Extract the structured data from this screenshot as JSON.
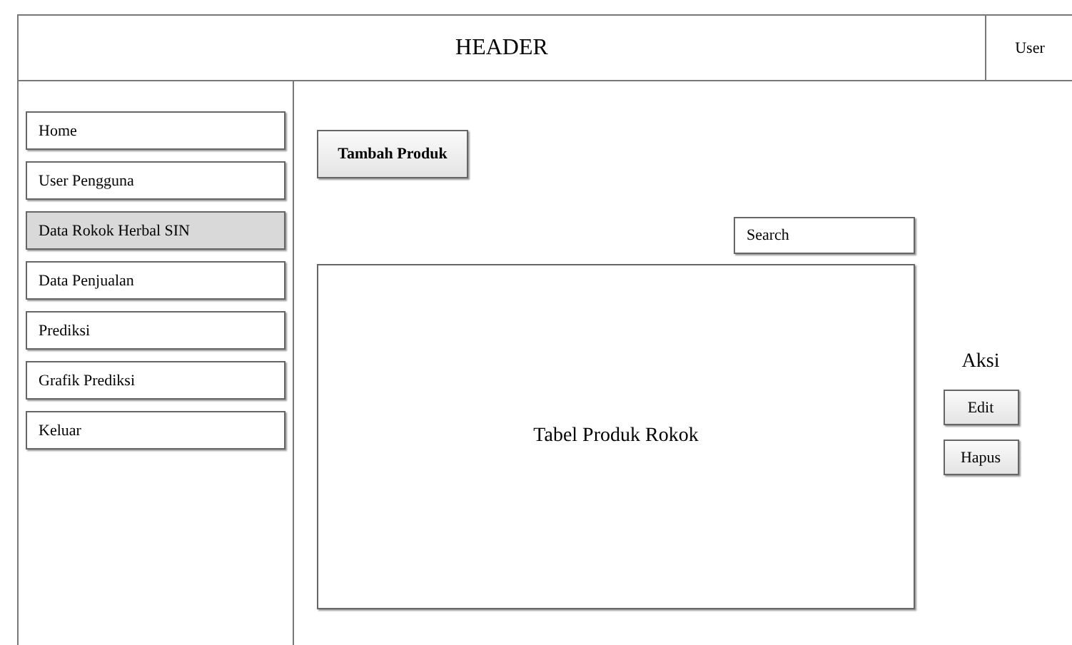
{
  "header": {
    "title": "HEADER",
    "user": "User"
  },
  "sidebar": {
    "items": [
      {
        "label": "Home",
        "selected": false
      },
      {
        "label": "User Pengguna",
        "selected": false
      },
      {
        "label": "Data Rokok Herbal SIN",
        "selected": true
      },
      {
        "label": "Data Penjualan",
        "selected": false
      },
      {
        "label": "Prediksi",
        "selected": false
      },
      {
        "label": "Grafik Prediksi",
        "selected": false
      },
      {
        "label": "Keluar",
        "selected": false
      }
    ]
  },
  "main": {
    "add_button": "Tambah Produk",
    "search": {
      "placeholder": "Search"
    },
    "table": {
      "label": "Tabel Produk Rokok"
    },
    "actions": {
      "title": "Aksi",
      "buttons": [
        "Edit",
        "Hapus"
      ]
    }
  }
}
